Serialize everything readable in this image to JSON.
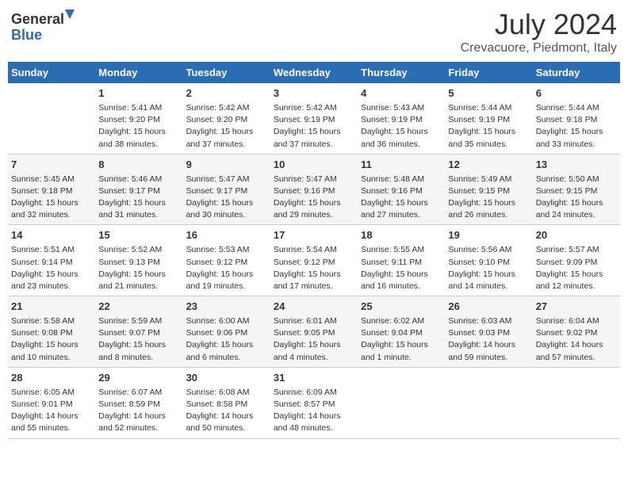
{
  "header": {
    "logo_line1": "General",
    "logo_line2": "Blue",
    "month": "July 2024",
    "location": "Crevacuore, Piedmont, Italy"
  },
  "columns": [
    "Sunday",
    "Monday",
    "Tuesday",
    "Wednesday",
    "Thursday",
    "Friday",
    "Saturday"
  ],
  "weeks": [
    [
      {
        "day": "",
        "info": ""
      },
      {
        "day": "1",
        "info": "Sunrise: 5:41 AM\nSunset: 9:20 PM\nDaylight: 15 hours\nand 38 minutes."
      },
      {
        "day": "2",
        "info": "Sunrise: 5:42 AM\nSunset: 9:20 PM\nDaylight: 15 hours\nand 37 minutes."
      },
      {
        "day": "3",
        "info": "Sunrise: 5:42 AM\nSunset: 9:19 PM\nDaylight: 15 hours\nand 37 minutes."
      },
      {
        "day": "4",
        "info": "Sunrise: 5:43 AM\nSunset: 9:19 PM\nDaylight: 15 hours\nand 36 minutes."
      },
      {
        "day": "5",
        "info": "Sunrise: 5:44 AM\nSunset: 9:19 PM\nDaylight: 15 hours\nand 35 minutes."
      },
      {
        "day": "6",
        "info": "Sunrise: 5:44 AM\nSunset: 9:18 PM\nDaylight: 15 hours\nand 33 minutes."
      }
    ],
    [
      {
        "day": "7",
        "info": "Sunrise: 5:45 AM\nSunset: 9:18 PM\nDaylight: 15 hours\nand 32 minutes."
      },
      {
        "day": "8",
        "info": "Sunrise: 5:46 AM\nSunset: 9:17 PM\nDaylight: 15 hours\nand 31 minutes."
      },
      {
        "day": "9",
        "info": "Sunrise: 5:47 AM\nSunset: 9:17 PM\nDaylight: 15 hours\nand 30 minutes."
      },
      {
        "day": "10",
        "info": "Sunrise: 5:47 AM\nSunset: 9:16 PM\nDaylight: 15 hours\nand 29 minutes."
      },
      {
        "day": "11",
        "info": "Sunrise: 5:48 AM\nSunset: 9:16 PM\nDaylight: 15 hours\nand 27 minutes."
      },
      {
        "day": "12",
        "info": "Sunrise: 5:49 AM\nSunset: 9:15 PM\nDaylight: 15 hours\nand 26 minutes."
      },
      {
        "day": "13",
        "info": "Sunrise: 5:50 AM\nSunset: 9:15 PM\nDaylight: 15 hours\nand 24 minutes."
      }
    ],
    [
      {
        "day": "14",
        "info": "Sunrise: 5:51 AM\nSunset: 9:14 PM\nDaylight: 15 hours\nand 23 minutes."
      },
      {
        "day": "15",
        "info": "Sunrise: 5:52 AM\nSunset: 9:13 PM\nDaylight: 15 hours\nand 21 minutes."
      },
      {
        "day": "16",
        "info": "Sunrise: 5:53 AM\nSunset: 9:12 PM\nDaylight: 15 hours\nand 19 minutes."
      },
      {
        "day": "17",
        "info": "Sunrise: 5:54 AM\nSunset: 9:12 PM\nDaylight: 15 hours\nand 17 minutes."
      },
      {
        "day": "18",
        "info": "Sunrise: 5:55 AM\nSunset: 9:11 PM\nDaylight: 15 hours\nand 16 minutes."
      },
      {
        "day": "19",
        "info": "Sunrise: 5:56 AM\nSunset: 9:10 PM\nDaylight: 15 hours\nand 14 minutes."
      },
      {
        "day": "20",
        "info": "Sunrise: 5:57 AM\nSunset: 9:09 PM\nDaylight: 15 hours\nand 12 minutes."
      }
    ],
    [
      {
        "day": "21",
        "info": "Sunrise: 5:58 AM\nSunset: 9:08 PM\nDaylight: 15 hours\nand 10 minutes."
      },
      {
        "day": "22",
        "info": "Sunrise: 5:59 AM\nSunset: 9:07 PM\nDaylight: 15 hours\nand 8 minutes."
      },
      {
        "day": "23",
        "info": "Sunrise: 6:00 AM\nSunset: 9:06 PM\nDaylight: 15 hours\nand 6 minutes."
      },
      {
        "day": "24",
        "info": "Sunrise: 6:01 AM\nSunset: 9:05 PM\nDaylight: 15 hours\nand 4 minutes."
      },
      {
        "day": "25",
        "info": "Sunrise: 6:02 AM\nSunset: 9:04 PM\nDaylight: 15 hours\nand 1 minute."
      },
      {
        "day": "26",
        "info": "Sunrise: 6:03 AM\nSunset: 9:03 PM\nDaylight: 14 hours\nand 59 minutes."
      },
      {
        "day": "27",
        "info": "Sunrise: 6:04 AM\nSunset: 9:02 PM\nDaylight: 14 hours\nand 57 minutes."
      }
    ],
    [
      {
        "day": "28",
        "info": "Sunrise: 6:05 AM\nSunset: 9:01 PM\nDaylight: 14 hours\nand 55 minutes."
      },
      {
        "day": "29",
        "info": "Sunrise: 6:07 AM\nSunset: 8:59 PM\nDaylight: 14 hours\nand 52 minutes."
      },
      {
        "day": "30",
        "info": "Sunrise: 6:08 AM\nSunset: 8:58 PM\nDaylight: 14 hours\nand 50 minutes."
      },
      {
        "day": "31",
        "info": "Sunrise: 6:09 AM\nSunset: 8:57 PM\nDaylight: 14 hours\nand 48 minutes."
      },
      {
        "day": "",
        "info": ""
      },
      {
        "day": "",
        "info": ""
      },
      {
        "day": "",
        "info": ""
      }
    ]
  ]
}
